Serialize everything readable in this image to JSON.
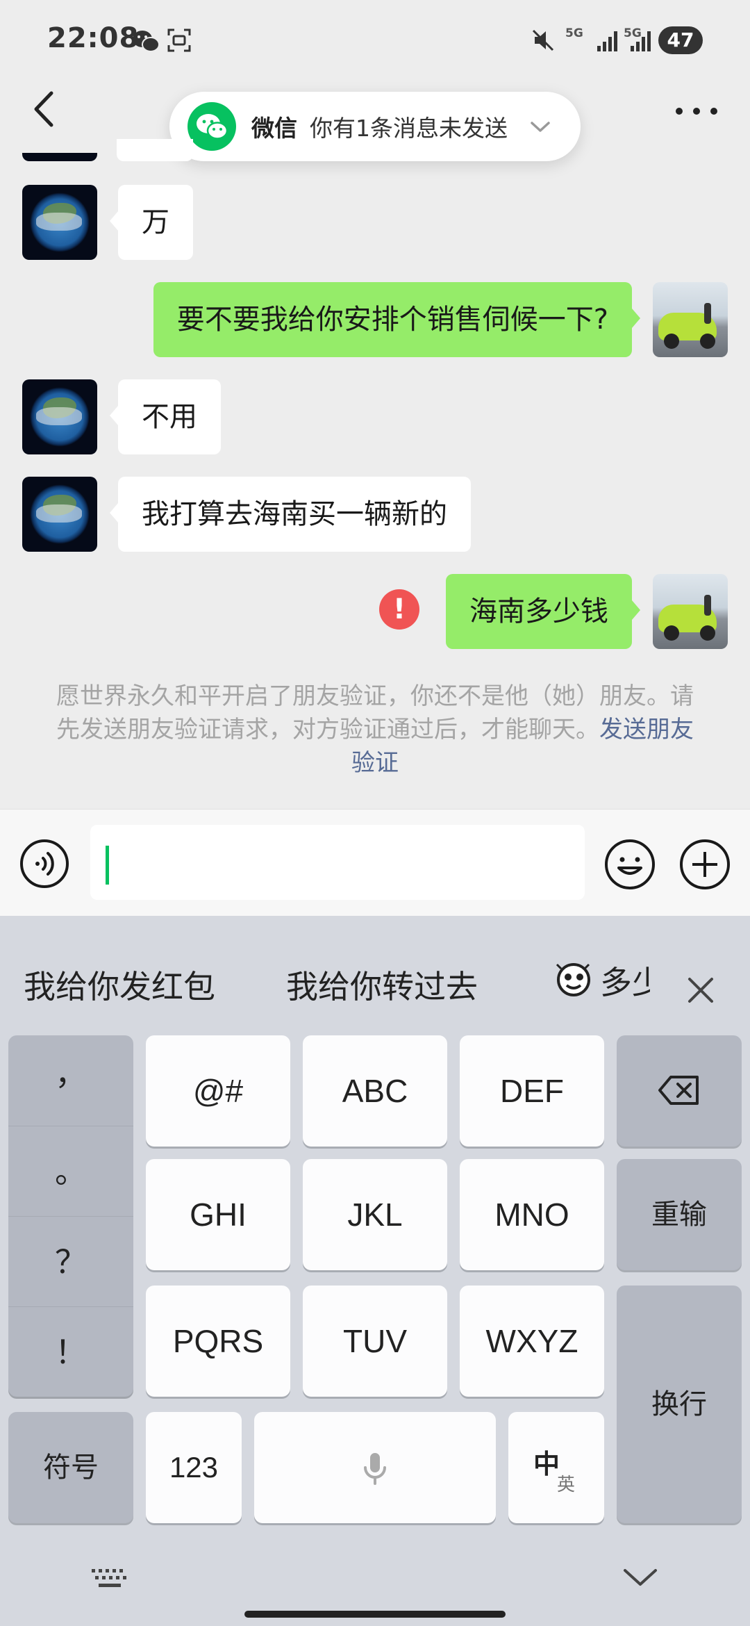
{
  "status_bar": {
    "time": "22:08",
    "battery": "47",
    "signal1_label": "5G",
    "signal2_label": "5G",
    "icons": [
      "wechat-icon",
      "screen-capture-icon",
      "mute-icon",
      "signal-icon",
      "battery-icon"
    ]
  },
  "notification": {
    "app_name": "微信",
    "message": "你有1条消息未发送"
  },
  "messages": [
    {
      "side": "in",
      "text": "万"
    },
    {
      "side": "out",
      "text": "要不要我给你安排个销售伺候一下?"
    },
    {
      "side": "in",
      "text": "不用"
    },
    {
      "side": "in",
      "text": "我打算去海南买一辆新的"
    },
    {
      "side": "out",
      "text": "海南多少钱",
      "status": "failed"
    }
  ],
  "system_notice": {
    "text": "愿世界永久和平开启了朋友验证，你还不是他（她）朋友。请先发送朋友验证请求，对方验证通过后，才能聊天。",
    "link": "发送朋友验证"
  },
  "input": {
    "value": ""
  },
  "suggestions": [
    "我给你发红包",
    "我给你转过去",
    "多少"
  ],
  "keyboard": {
    "punctuation": [
      "，",
      "。",
      "？",
      "！"
    ],
    "row1": [
      "@#",
      "ABC",
      "DEF"
    ],
    "row2": [
      "GHI",
      "JKL",
      "MNO"
    ],
    "row3": [
      "PQRS",
      "TUV",
      "WXYZ"
    ],
    "reenter": "重输",
    "newline": "换行",
    "symbols": "符号",
    "num": "123",
    "lang_main": "中",
    "lang_sub": "英"
  },
  "colors": {
    "accent": "#07c160",
    "out_bubble": "#95ec69",
    "error": "#f05454",
    "link": "#576b95"
  }
}
